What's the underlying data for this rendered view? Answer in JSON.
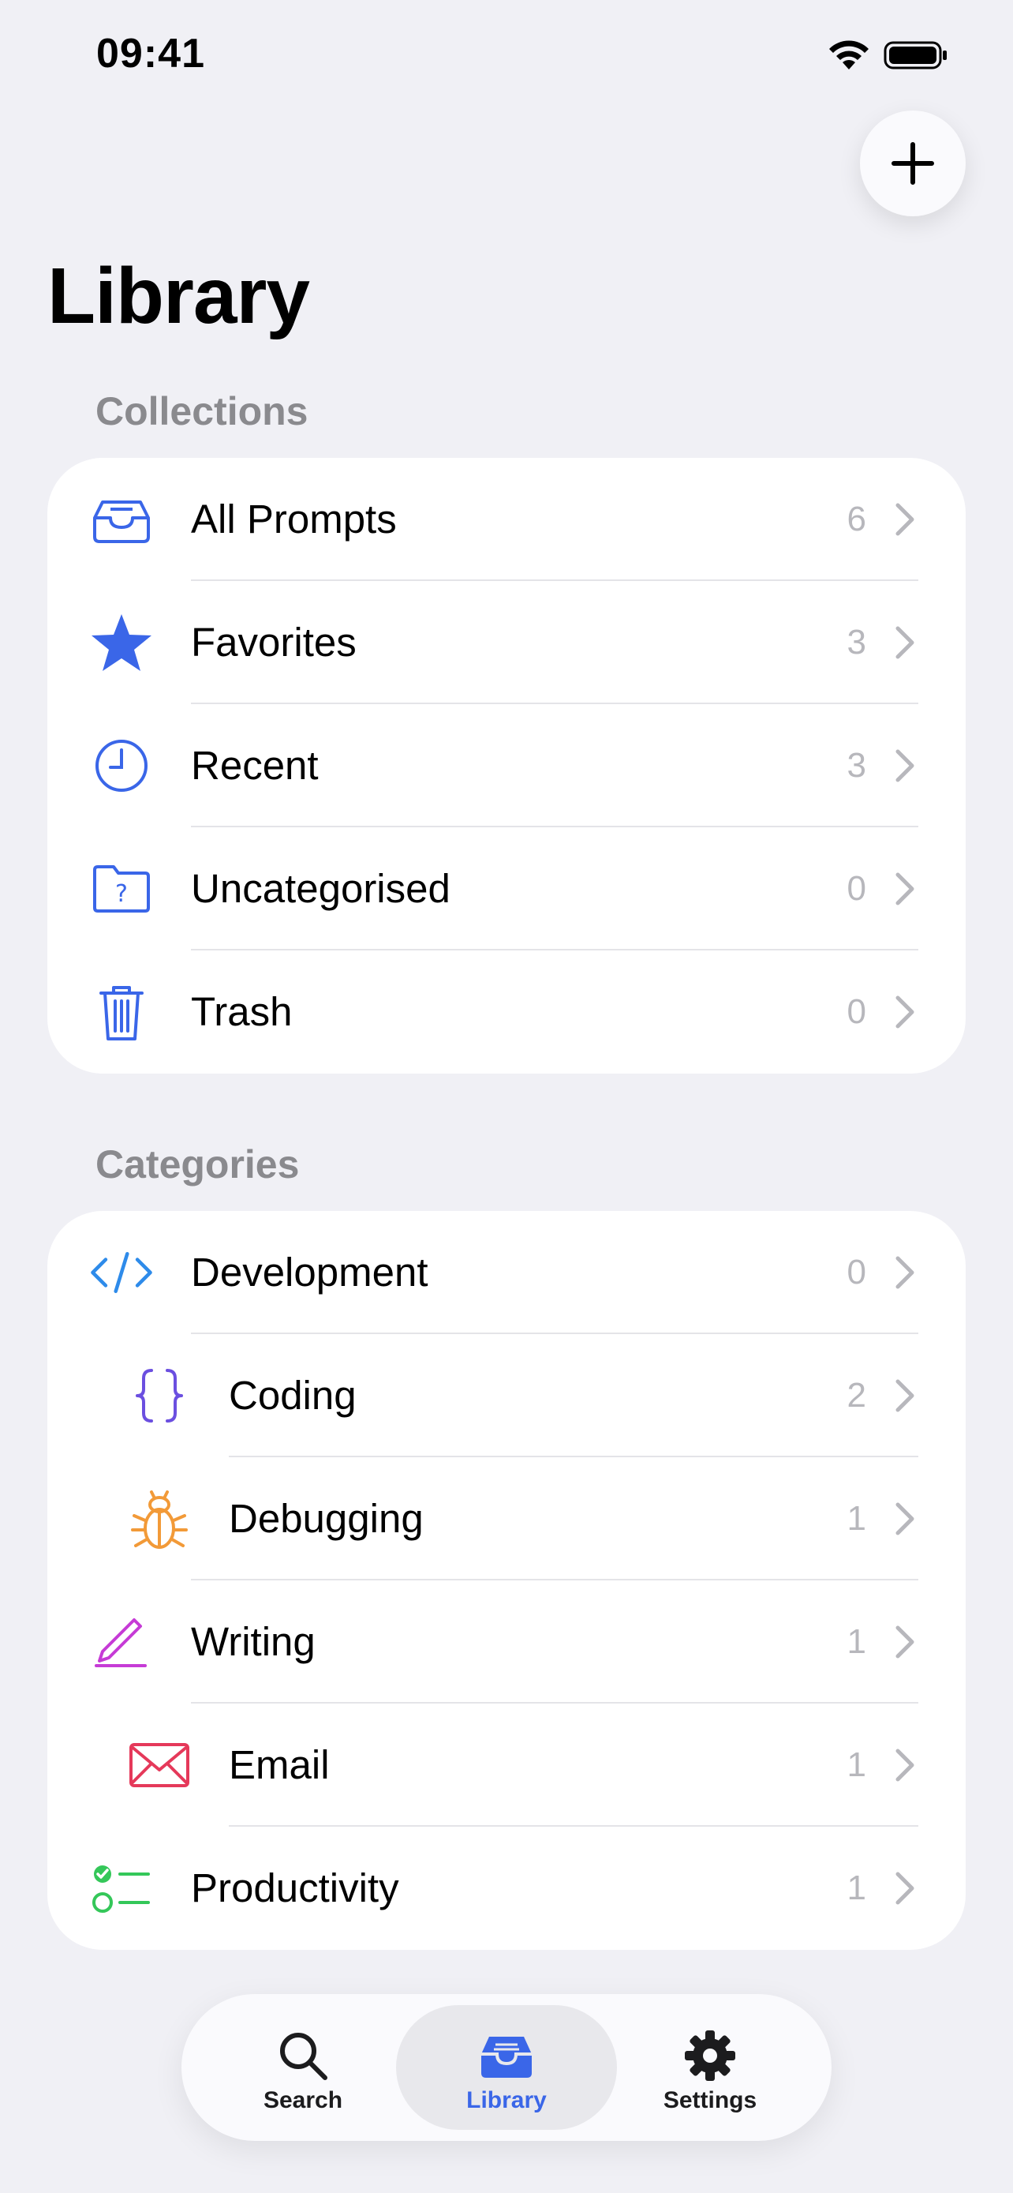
{
  "status": {
    "time": "09:41"
  },
  "header": {
    "title": "Library"
  },
  "colors": {
    "accent": "#3A66E8",
    "background": "#F0F0F5",
    "count": "#B7B7BC",
    "section": "#8A8A8E"
  },
  "collections": {
    "title": "Collections",
    "items": [
      {
        "label": "All Prompts",
        "count": "6",
        "icon": "tray-icon"
      },
      {
        "label": "Favorites",
        "count": "3",
        "icon": "star-icon"
      },
      {
        "label": "Recent",
        "count": "3",
        "icon": "clock-icon"
      },
      {
        "label": "Uncategorised",
        "count": "0",
        "icon": "folder-question-icon"
      },
      {
        "label": "Trash",
        "count": "0",
        "icon": "trash-icon"
      }
    ]
  },
  "categories": {
    "title": "Categories",
    "items": [
      {
        "label": "Development",
        "count": "0",
        "icon": "code-icon",
        "color": "#2E8BEA"
      },
      {
        "label": "Coding",
        "count": "2",
        "icon": "braces-icon",
        "color": "#6B4FE0"
      },
      {
        "label": "Debugging",
        "count": "1",
        "icon": "bug-icon",
        "color": "#F29A38"
      },
      {
        "label": "Writing",
        "count": "1",
        "icon": "pencil-icon",
        "color": "#C63BD6"
      },
      {
        "label": "Email",
        "count": "1",
        "icon": "envelope-icon",
        "color": "#E5395A"
      },
      {
        "label": "Productivity",
        "count": "1",
        "icon": "checklist-icon",
        "color": "#34C759"
      }
    ]
  },
  "tabbar": {
    "items": [
      {
        "label": "Search",
        "icon": "search-icon"
      },
      {
        "label": "Library",
        "icon": "tray-icon",
        "active": true
      },
      {
        "label": "Settings",
        "icon": "gear-icon"
      }
    ]
  }
}
